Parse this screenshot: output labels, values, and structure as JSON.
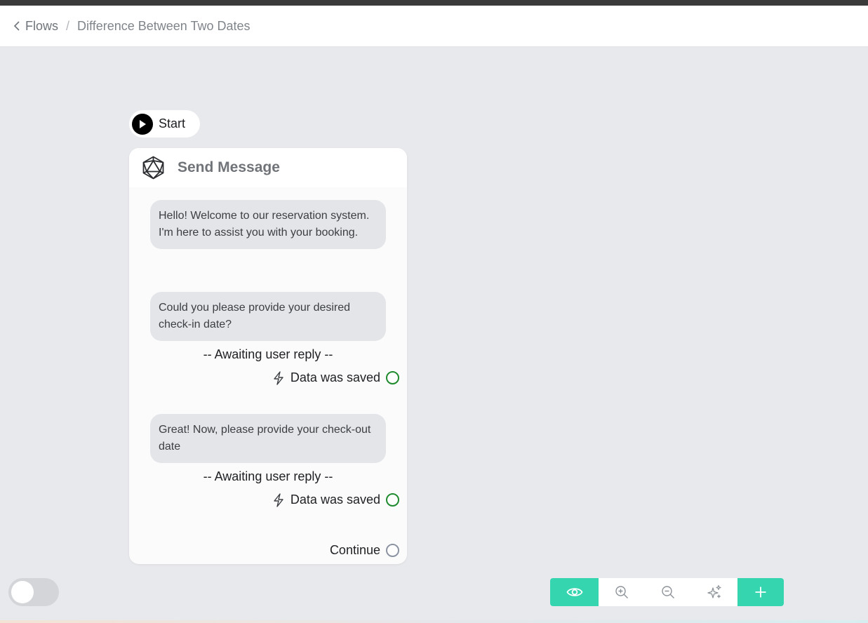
{
  "breadcrumb": {
    "back_label": "Flows",
    "separator": "/",
    "current": "Difference Between Two Dates"
  },
  "start_node": {
    "label": "Start"
  },
  "node": {
    "title": "Send Message",
    "messages": [
      "Hello! Welcome to our reservation system. I'm here to assist you with your booking.",
      "Could you please provide your desired check-in date?",
      "Great! Now, please provide your check-out date"
    ],
    "awaiting_1": "-- Awaiting user reply --",
    "saved_1": "Data was saved",
    "awaiting_2": "-- Awaiting user reply --",
    "saved_2": "Data was saved",
    "continue_label": "Continue"
  },
  "toolbar": {
    "buttons": [
      "eye-icon",
      "zoom-in-icon",
      "zoom-out-icon",
      "sparkle-icon",
      "plus-icon"
    ]
  },
  "colors": {
    "accent": "#35d5b0",
    "canvas": "#e8e9ec",
    "saved_port": "#1f8a2e",
    "continue_port": "#8c93a3"
  }
}
